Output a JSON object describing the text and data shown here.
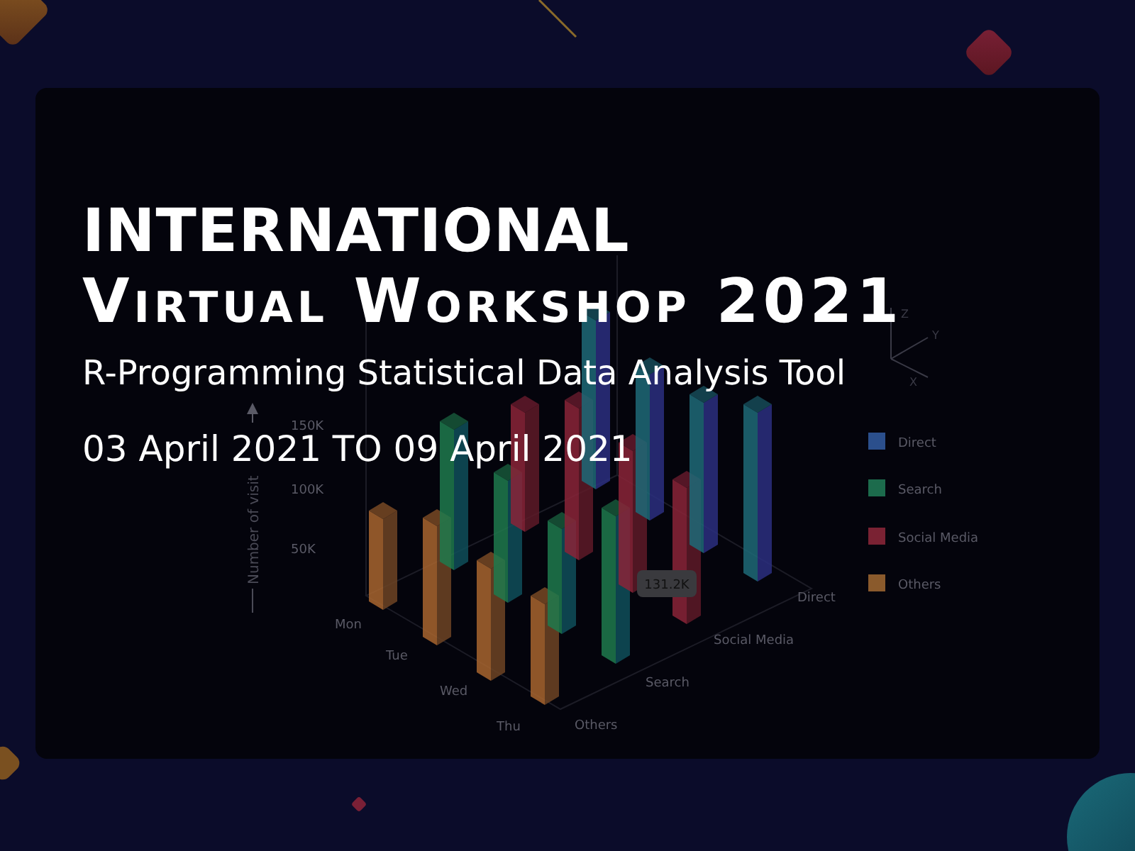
{
  "title": {
    "line_1": "INTERNATIONAL",
    "line_2": "Virtual Workshop 2021"
  },
  "subtitle": "R-Programming Statistical Data Analysis Tool",
  "dates": "03 April 2021 TO 09 April 2021",
  "chart": {
    "y_axis_label": "Number of visit",
    "y_ticks": [
      "150K",
      "100K",
      "50K"
    ],
    "days": [
      "Mon",
      "Tue",
      "Wed",
      "Thu"
    ],
    "channels": [
      "Others",
      "Search",
      "Social Media",
      "Direct"
    ],
    "axis_letters": [
      "Z",
      "Y",
      "X"
    ],
    "tooltip": "131.2K",
    "legend": [
      {
        "label": "Direct",
        "color": "#2b4f8c"
      },
      {
        "label": "Search",
        "color": "#1c6b4c"
      },
      {
        "label": "Social Media",
        "color": "#7a2233"
      },
      {
        "label": "Others",
        "color": "#8a5a2c"
      }
    ]
  }
}
